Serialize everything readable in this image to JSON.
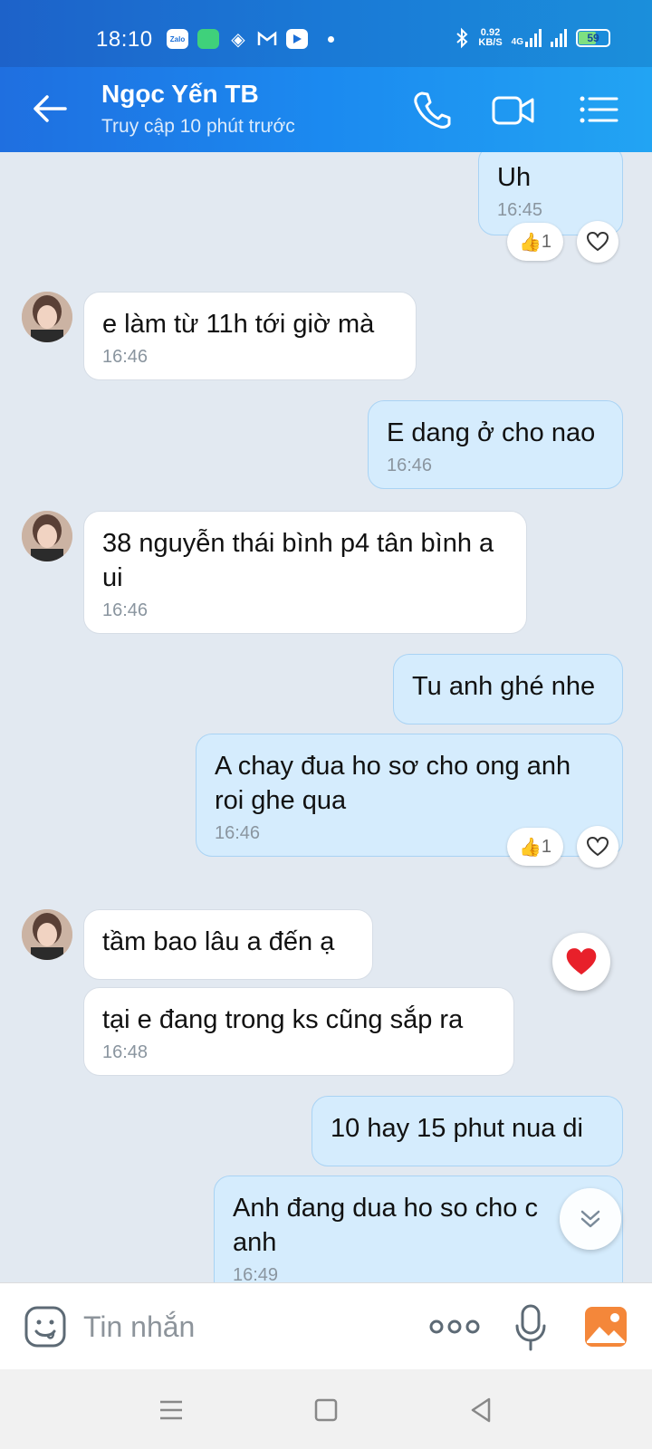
{
  "status_bar": {
    "time": "18:10",
    "app_icons": [
      "zalo-icon",
      "chat-app-icon",
      "diamond-app-icon",
      "gmail-icon",
      "video-app-icon"
    ],
    "zalo_label": "Zalo",
    "speed_value": "0.92",
    "speed_unit": "KB/S",
    "network": "4G",
    "battery": "59"
  },
  "header": {
    "contact_name": "Ngọc Yến TB",
    "last_seen": "Truy cập 10 phút trước"
  },
  "messages": [
    {
      "dir": "out",
      "text": "Uh",
      "time": "16:45",
      "reaction": "👍",
      "reaction_count": "1"
    },
    {
      "dir": "in",
      "text": "e làm từ 11h tới giờ mà",
      "time": "16:46"
    },
    {
      "dir": "out",
      "text": "E dang ở cho nao",
      "time": "16:46"
    },
    {
      "dir": "in",
      "text": "38 nguyễn thái bình p4 tân bình a ui",
      "time": "16:46"
    },
    {
      "dir": "out",
      "text": "Tu anh ghé nhe",
      "time": ""
    },
    {
      "dir": "out",
      "text": "A chay đua ho sơ cho ong anh roi ghe qua",
      "time": "16:46",
      "reaction": "👍",
      "reaction_count": "1"
    },
    {
      "dir": "in",
      "text": "tầm bao lâu a đến ạ",
      "time": ""
    },
    {
      "dir": "in",
      "text": "tại e đang trong ks cũng sắp ra",
      "time": "16:48"
    },
    {
      "dir": "out",
      "text": "10 hay 15 phut nua di",
      "time": ""
    },
    {
      "dir": "out",
      "text": "Anh đang dua ho so cho c anh",
      "time": "16:49"
    }
  ],
  "input": {
    "placeholder": "Tin nhắn"
  },
  "colors": {
    "header_start": "#1f6fe0",
    "header_end": "#22a4f3",
    "outgoing_bubble": "#d5ecfd",
    "incoming_bubble": "#ffffff",
    "chat_background": "#e2e9f1",
    "heart": "#e8202a"
  }
}
